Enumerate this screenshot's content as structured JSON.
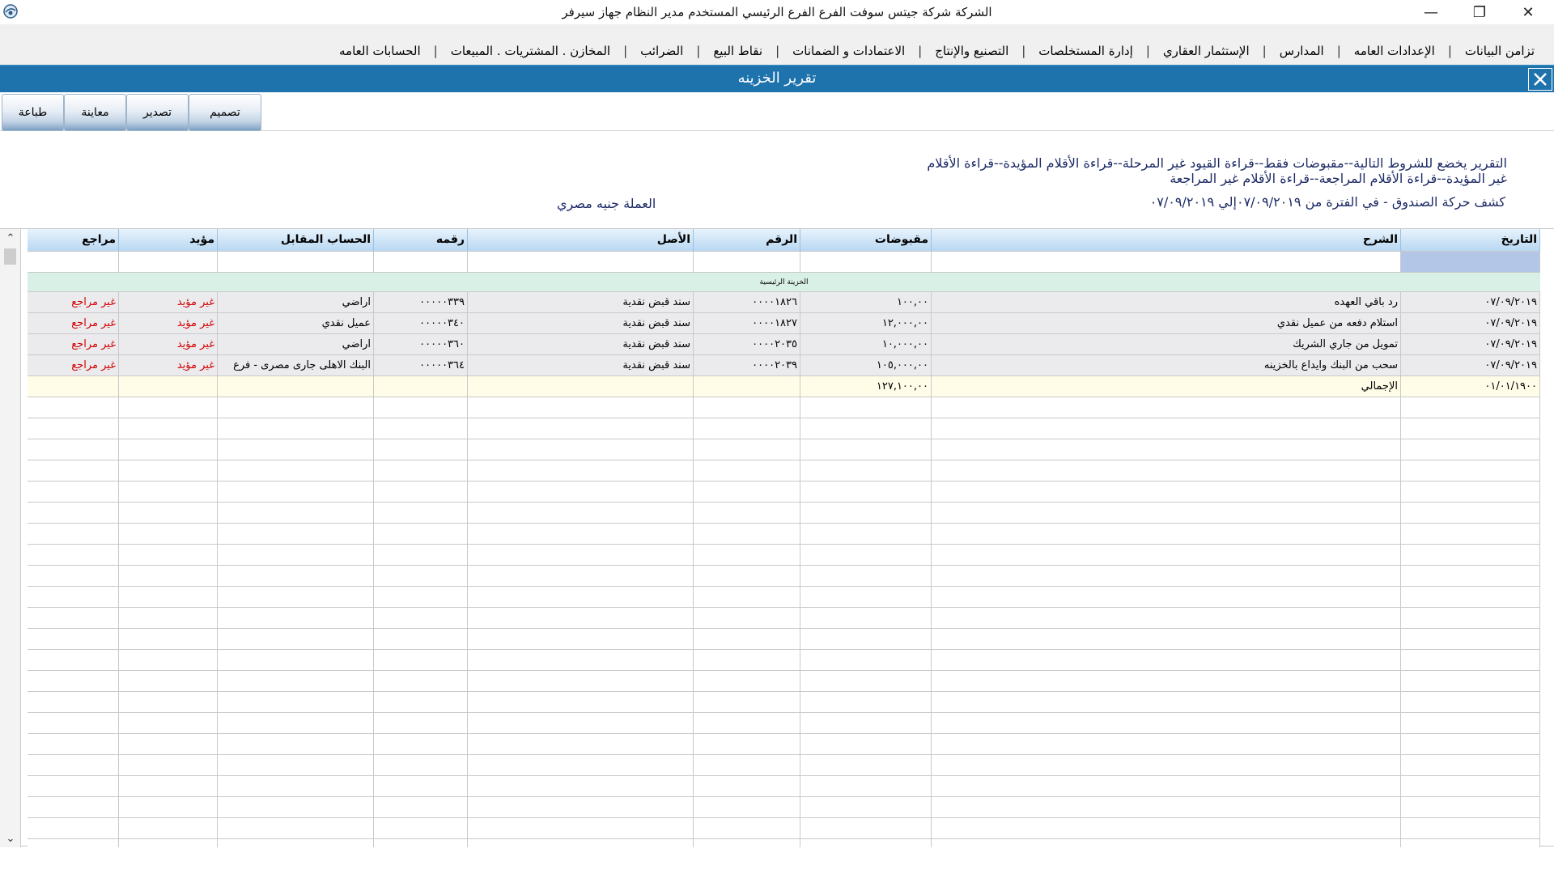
{
  "window": {
    "title": "الشركة شركة جيتس سوفت   الفرع الفرع الرئيسي   المستخدم مدير النظام   جهاز سيرفر",
    "minimize": "—",
    "restore": "❐",
    "close": "✕"
  },
  "menu": [
    "الحسابات العامه",
    "المخازن . المشتريات . المبيعات",
    "الضرائب",
    "نقاط البيع",
    "الاعتمادات و الضمانات",
    "التصنيع والإنتاج",
    "إدارة المستخلصات",
    "الإستثمار العقاري",
    "المدارس",
    "الإعدادات العامه",
    "تزامن البيانات"
  ],
  "menu_separator": "|",
  "report": {
    "window_title": "تقرير الخزينه",
    "close_icon": "close-x-icon",
    "heading": "كشف حركة الصندوق -    في الفترة من ٠٧/٠٩/٢٠١٩إلي ٠٧/٠٩/٢٠١٩",
    "conditions": "التقرير يخضع للشروط التالية--مقبوضات فقط--قراءة القيود غير المرحلة--قراءة الأقلام المؤيدة--قراءة الأقلام غير المؤيدة--قراءة الأقلام المراجعة--قراءة الأقلام غير المراجعة",
    "currency": "العملة جنيه مصري"
  },
  "toolbar": {
    "design": "تصميم",
    "export": "تصدير",
    "preview": "معاينة",
    "print": "طباعة"
  },
  "scroll": {
    "up": "⌃",
    "down": "⌄"
  },
  "table": {
    "headers": {
      "date": "التاريخ",
      "description": "الشرح",
      "receipts": "مقبوضات",
      "number": "الرقم",
      "origin": "الأصل",
      "ref_no": "رقمه",
      "counter_account": "الحساب المقابل",
      "approved": "مؤيد",
      "reviewed": "مراجع"
    },
    "group_label": "الخزينة الرئيسية",
    "rows": [
      {
        "date": "٠٧/٠٩/٢٠١٩",
        "description": "رد باقي العهده",
        "receipts": "١٠٠,٠٠",
        "number": "٠٠٠٠١٨٢٦",
        "origin": "سند قبض نقدية",
        "ref_no": "٠٠٠٠٠٣٣٩",
        "counter_account": "اراضي",
        "approved": "غير مؤيد",
        "reviewed": "غير مراجع"
      },
      {
        "date": "٠٧/٠٩/٢٠١٩",
        "description": "استلام دفعه من عميل نقدي",
        "receipts": "١٢,٠٠٠,٠٠",
        "number": "٠٠٠٠١٨٢٧",
        "origin": "سند قبض نقدية",
        "ref_no": "٠٠٠٠٠٣٤٠",
        "counter_account": "عميل نقدي",
        "approved": "غير مؤيد",
        "reviewed": "غير مراجع"
      },
      {
        "date": "٠٧/٠٩/٢٠١٩",
        "description": "تمويل من جاري الشريك",
        "receipts": "١٠,٠٠٠,٠٠",
        "number": "٠٠٠٠٢٠٣٥",
        "origin": "سند قبض نقدية",
        "ref_no": "٠٠٠٠٠٣٦٠",
        "counter_account": "اراضي",
        "approved": "غير مؤيد",
        "reviewed": "غير مراجع"
      },
      {
        "date": "٠٧/٠٩/٢٠١٩",
        "description": "سحب من البنك وايداع بالخزينه",
        "receipts": "١٠٥,٠٠٠,٠٠",
        "number": "٠٠٠٠٢٠٣٩",
        "origin": "سند قبض نقدية",
        "ref_no": "٠٠٠٠٠٣٦٤",
        "counter_account": "البنك الاهلى جارى مصرى - فرع",
        "approved": "غير مؤيد",
        "reviewed": "غير مراجع"
      }
    ],
    "total": {
      "date": "٠١/٠١/١٩٠٠",
      "description": "الإجمالي",
      "receipts": "١٢٧,١٠٠,٠٠"
    }
  }
}
